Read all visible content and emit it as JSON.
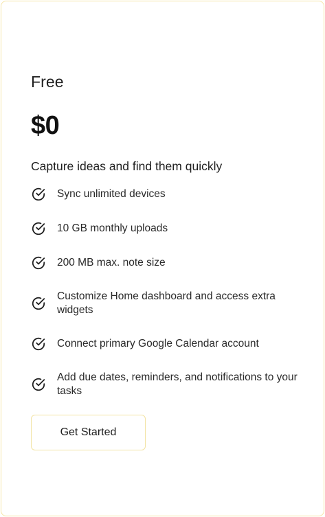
{
  "plan": {
    "name": "Free",
    "price": "$0",
    "description": "Capture ideas and find them quickly"
  },
  "features": [
    {
      "label": "Sync unlimited devices",
      "icon": "check-circle-icon"
    },
    {
      "label": "10 GB monthly uploads",
      "icon": "check-circle-icon"
    },
    {
      "label": "200 MB max. note size",
      "icon": "check-circle-icon"
    },
    {
      "label": "Customize Home dashboard and access extra widgets",
      "icon": "check-circle-icon"
    },
    {
      "label": "Connect primary Google Calendar account",
      "icon": "check-circle-icon"
    },
    {
      "label": "Add due dates, reminders, and notifications to your tasks",
      "icon": "check-circle-icon"
    }
  ],
  "cta": {
    "label": "Get Started"
  },
  "colors": {
    "card_border": "#f6e6a6",
    "button_border": "#f2e3a3",
    "text": "#1f1f1f"
  }
}
